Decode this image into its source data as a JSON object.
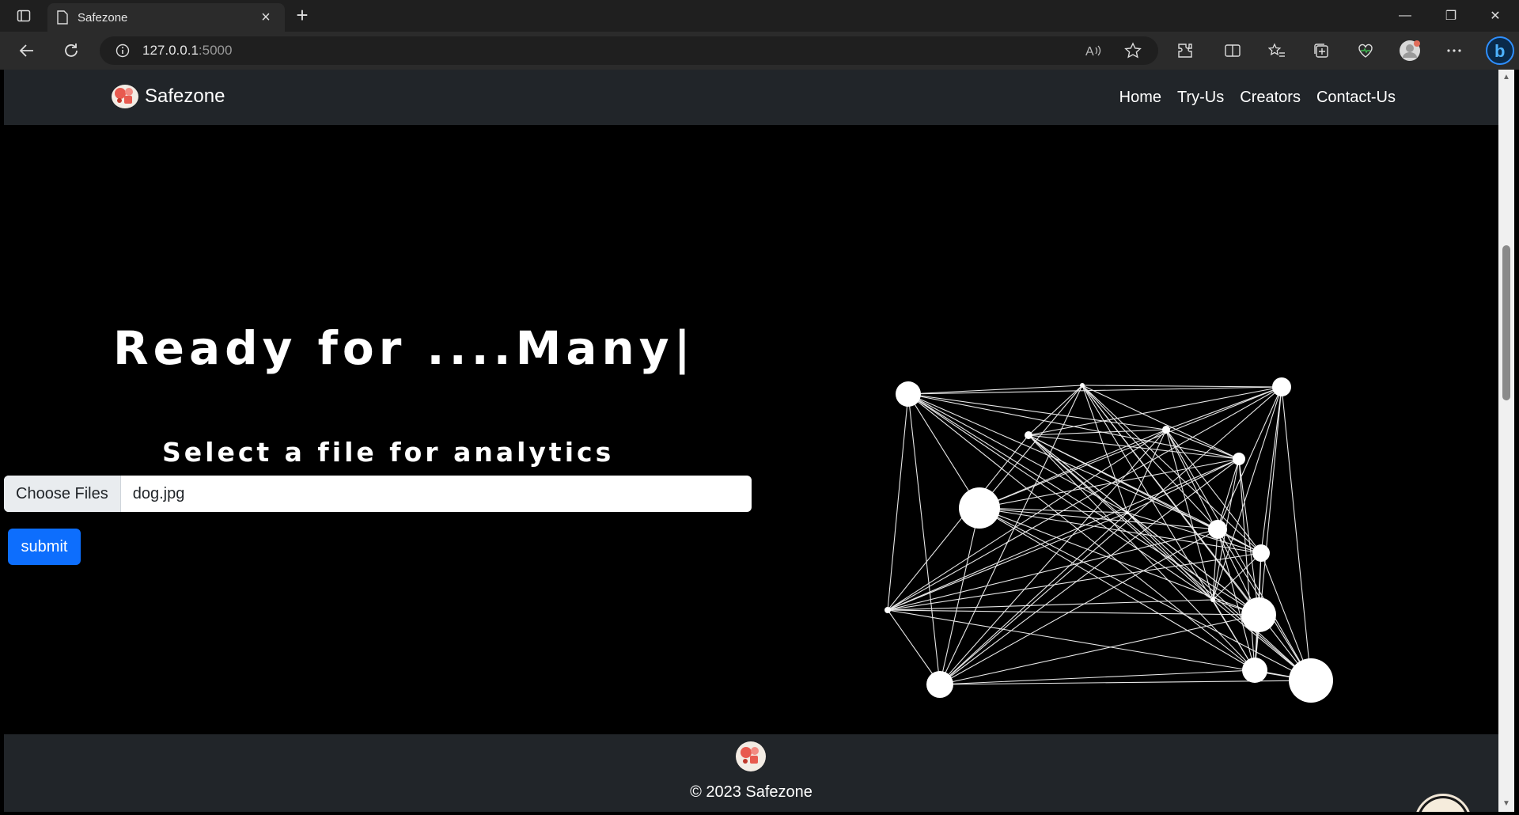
{
  "browser": {
    "tab_title": "Safezone",
    "tab_close": "×",
    "new_tab": "+",
    "url_host": "127.0.0.1",
    "url_port": ":5000",
    "window_controls": [
      "—",
      "❐",
      "✕"
    ]
  },
  "navbar": {
    "brand": "Safezone",
    "links": [
      "Home",
      "Try-Us",
      "Creators",
      "Contact-Us"
    ]
  },
  "hero": {
    "title": "Ready for ....Many|",
    "select_label": "Select a file for analytics"
  },
  "upload": {
    "button_label": "Choose Files",
    "file_name": "dog.jpg",
    "submit_label": "submit"
  },
  "footer": {
    "copyright": "© 2023 Safezone"
  },
  "colors": {
    "navbar_bg": "#212529",
    "submit_bg": "#0d6efd",
    "page_bg": "#000000"
  }
}
